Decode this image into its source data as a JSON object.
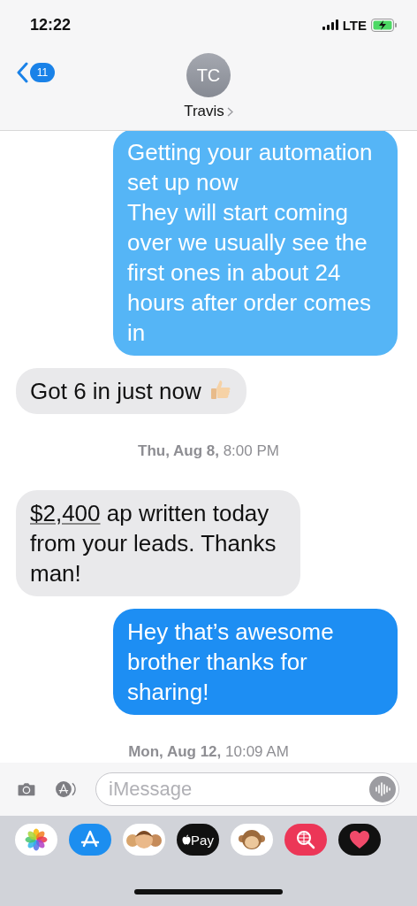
{
  "status_bar": {
    "time": "12:22",
    "network": "LTE"
  },
  "header": {
    "back_count": "11",
    "initials": "TC",
    "name": "Travis"
  },
  "messages": [
    {
      "kind": "sent",
      "color": "#55b5f6",
      "text": "Getting your automation set up now\nThey will start coming over we usually see the first ones in about 24 hours after order comes in"
    },
    {
      "kind": "received",
      "text": "Got 6 in just now",
      "thumbs_up": true
    },
    {
      "kind": "timestamp",
      "text": "**Thu, Aug 8,** 8:00 PM"
    },
    {
      "kind": "received",
      "link": "$2,400",
      "text": "ap written today from your leads. Thanks man!"
    },
    {
      "kind": "sent",
      "color": "#1d8ef3",
      "text": "Hey that’s awesome brother thanks for sharing!"
    },
    {
      "kind": "timestamp",
      "text": "**Mon, Aug 12,** 10:09 AM"
    }
  ],
  "composer": {
    "placeholder": "iMessage"
  },
  "apps": [
    {
      "kind": "photos"
    },
    {
      "kind": "store"
    },
    {
      "kind": "memoji"
    },
    {
      "kind": "pay",
      "label": "Pay"
    },
    {
      "kind": "monkey"
    },
    {
      "kind": "search"
    },
    {
      "kind": "heart"
    }
  ]
}
